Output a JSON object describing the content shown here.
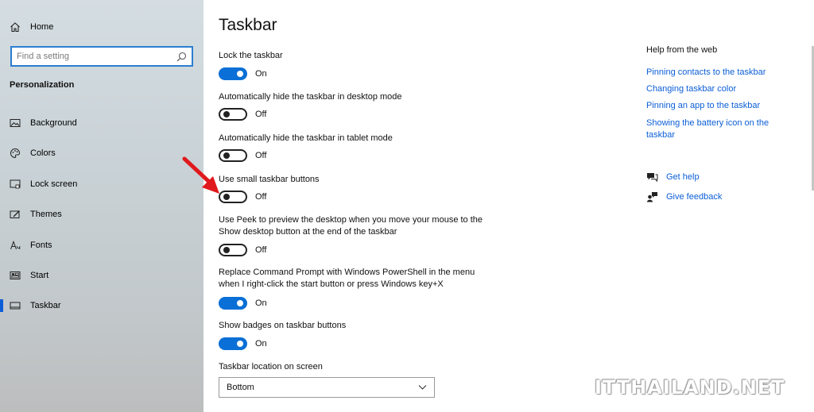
{
  "sidebar": {
    "home_label": "Home",
    "search_placeholder": "Find a setting",
    "section_title": "Personalization",
    "items": [
      {
        "label": "Background",
        "icon": "image-icon"
      },
      {
        "label": "Colors",
        "icon": "palette-icon"
      },
      {
        "label": "Lock screen",
        "icon": "lock-screen-icon"
      },
      {
        "label": "Themes",
        "icon": "themes-icon"
      },
      {
        "label": "Fonts",
        "icon": "fonts-icon"
      },
      {
        "label": "Start",
        "icon": "start-icon"
      },
      {
        "label": "Taskbar",
        "icon": "taskbar-icon",
        "active": true
      }
    ]
  },
  "main": {
    "title": "Taskbar",
    "settings": [
      {
        "label": "Lock the taskbar",
        "state": "On"
      },
      {
        "label": "Automatically hide the taskbar in desktop mode",
        "state": "Off"
      },
      {
        "label": "Automatically hide the taskbar in tablet mode",
        "state": "Off"
      },
      {
        "label": "Use small taskbar buttons",
        "state": "Off"
      },
      {
        "label": "Use Peek to preview the desktop when you move your mouse to the Show desktop button at the end of the taskbar",
        "state": "Off"
      },
      {
        "label": "Replace Command Prompt with Windows PowerShell in the menu when I right-click the start button or press Windows key+X",
        "state": "On"
      },
      {
        "label": "Show badges on taskbar buttons",
        "state": "On"
      }
    ],
    "location_label": "Taskbar location on screen",
    "location_value": "Bottom"
  },
  "help": {
    "title": "Help from the web",
    "links": [
      "Pinning contacts to the taskbar",
      "Changing taskbar color",
      "Pinning an app to the taskbar",
      "Showing the battery icon on the taskbar"
    ],
    "get_help": "Get help",
    "give_feedback": "Give feedback"
  },
  "watermark": "ITTHAILAND.NET",
  "colors": {
    "accent": "#0a6fd6",
    "link": "#0b5ed7",
    "annotation_arrow": "#e0191c"
  }
}
